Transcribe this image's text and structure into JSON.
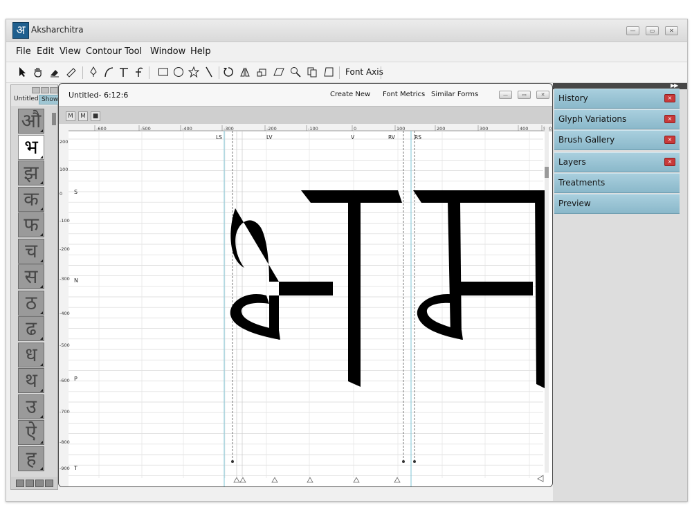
{
  "app": {
    "title": "Aksharchitra",
    "logo_glyph": "अ",
    "window_controls": [
      "—",
      "▭",
      "✕"
    ]
  },
  "menu": [
    "File",
    "Edit",
    "View",
    "Contour",
    "Tool",
    "Window",
    "Help"
  ],
  "toolbar": {
    "font_axis_label": "Font Axis",
    "tools": [
      "pointer",
      "hand",
      "pen",
      "ruler",
      "pen-nib",
      "curve",
      "corner-t",
      "hook",
      "rectangle",
      "ellipse",
      "star",
      "line",
      "rotate",
      "mirror",
      "transform",
      "skew",
      "zoom",
      "copy",
      "shape"
    ]
  },
  "palette": {
    "untitled_label": "Untitled",
    "show_label": "Show",
    "glyphs": [
      "औ",
      "भ",
      "झ",
      "क",
      "फ",
      "च",
      "स",
      "ठ",
      "ढ",
      "ध",
      "थ",
      "उ",
      "ऐ",
      "ह"
    ],
    "selected_index": 1
  },
  "editor": {
    "title": "Untitled- 6:12:6",
    "actions": [
      "Create New",
      "Font Metrics",
      "Similar Forms"
    ],
    "toolbar_icons": [
      "M",
      "M",
      "■"
    ],
    "ruler_x": [
      "-600",
      "-500",
      "-400",
      "-300",
      "-200",
      "-100",
      "0",
      "100",
      "200",
      "300",
      "400",
      "500"
    ],
    "ruler_y": [
      "200",
      "100",
      "0",
      "-100",
      "-200",
      "-300",
      "-400",
      "-500",
      "-600",
      "-700",
      "-800",
      "-900"
    ],
    "guide_labels": [
      "LS",
      "LV",
      "V",
      "RV",
      "RS"
    ],
    "row_labels": [
      "S",
      "N",
      "P",
      "T"
    ],
    "glyph_text": "भम"
  },
  "panel": {
    "items": [
      {
        "label": "History",
        "closable": true
      },
      {
        "label": "Glyph Variations",
        "closable": true
      },
      {
        "label": "Brush Gallery",
        "closable": true
      },
      {
        "label": "Layers",
        "closable": true
      },
      {
        "label": "Treatments",
        "closable": false
      },
      {
        "label": "Preview",
        "closable": false
      }
    ],
    "collapse_label": "▶▶"
  }
}
